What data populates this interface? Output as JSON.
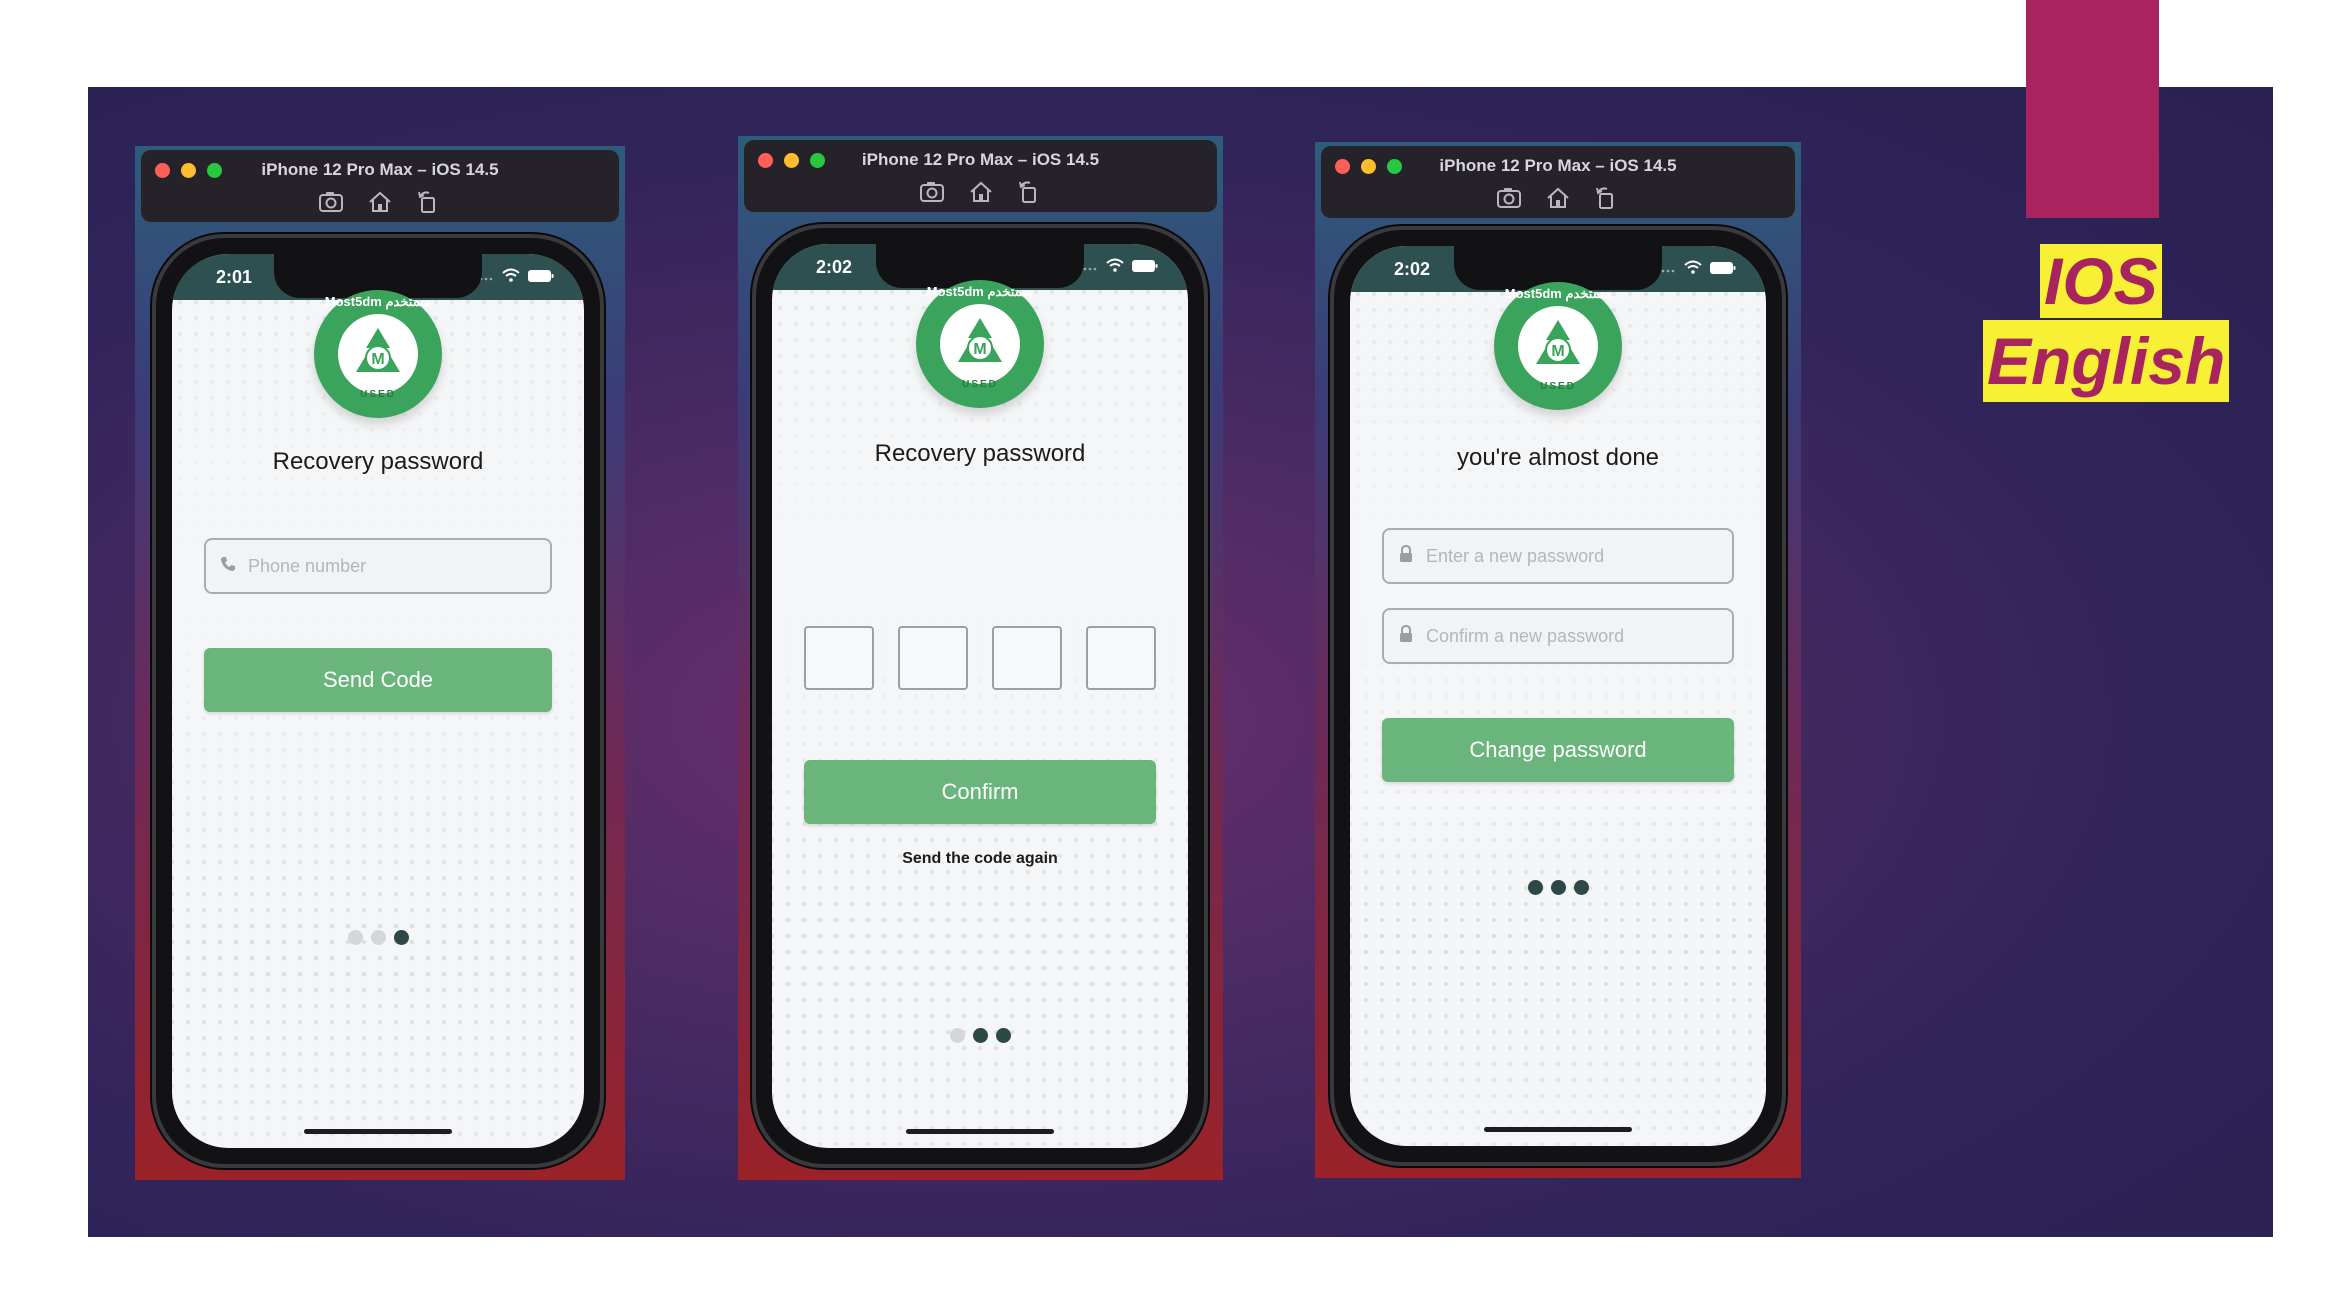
{
  "labels": {
    "platform": "IOS",
    "language": "English"
  },
  "simulators": [
    {
      "window_title": "iPhone 12 Pro Max – iOS 14.5",
      "status_time": "2:01",
      "heading": "Recovery password",
      "phone_placeholder": "Phone number",
      "button_label": "Send Code",
      "pager": [
        "off",
        "off",
        "on"
      ]
    },
    {
      "window_title": "iPhone 12 Pro Max – iOS 14.5",
      "status_time": "2:02",
      "heading": "Recovery password",
      "button_label": "Confirm",
      "resend_label": "Send the code again",
      "pager": [
        "off",
        "on",
        "on"
      ]
    },
    {
      "window_title": "iPhone 12 Pro Max – iOS 14.5",
      "status_time": "2:02",
      "heading": "you're almost done",
      "new_password_placeholder": "Enter a new password",
      "confirm_password_placeholder": "Confirm a new password",
      "button_label": "Change password",
      "pager": [
        "on",
        "on",
        "on"
      ]
    }
  ],
  "logo": {
    "ring_text": "Most5dm مستخدم",
    "center_letter": "M",
    "badge_text": "USED"
  },
  "colors": {
    "accent": "#a8245e",
    "highlight": "#f7f035",
    "button_green": "#69b57c",
    "status_bar": "#2e5050"
  }
}
